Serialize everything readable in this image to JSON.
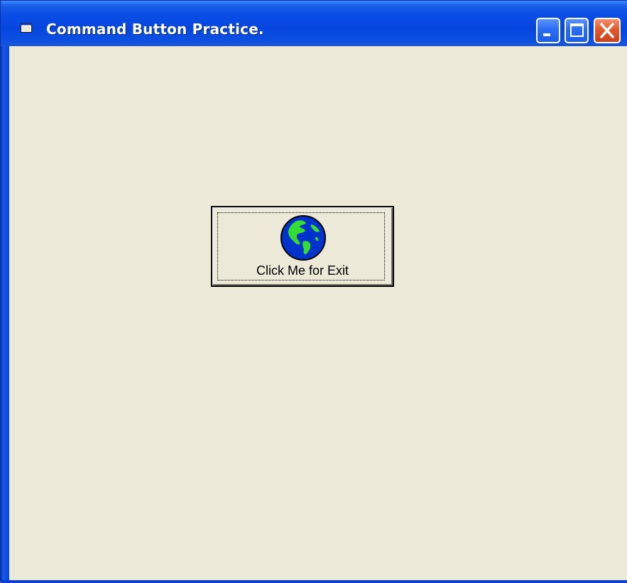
{
  "window": {
    "title": "Command Button Practice."
  },
  "title_controls": {
    "minimize_icon": "minimize-icon",
    "maximize_icon": "maximize-icon",
    "close_icon": "close-icon"
  },
  "form": {
    "command_button": {
      "label": "Click Me for Exit",
      "icon": "globe-icon"
    }
  },
  "colors": {
    "titlebar": "#0a4ee6",
    "client_background": "#ece9d8",
    "close_button": "#e15a2e",
    "globe_ocean": "#0033cc",
    "globe_land": "#33dd33"
  }
}
